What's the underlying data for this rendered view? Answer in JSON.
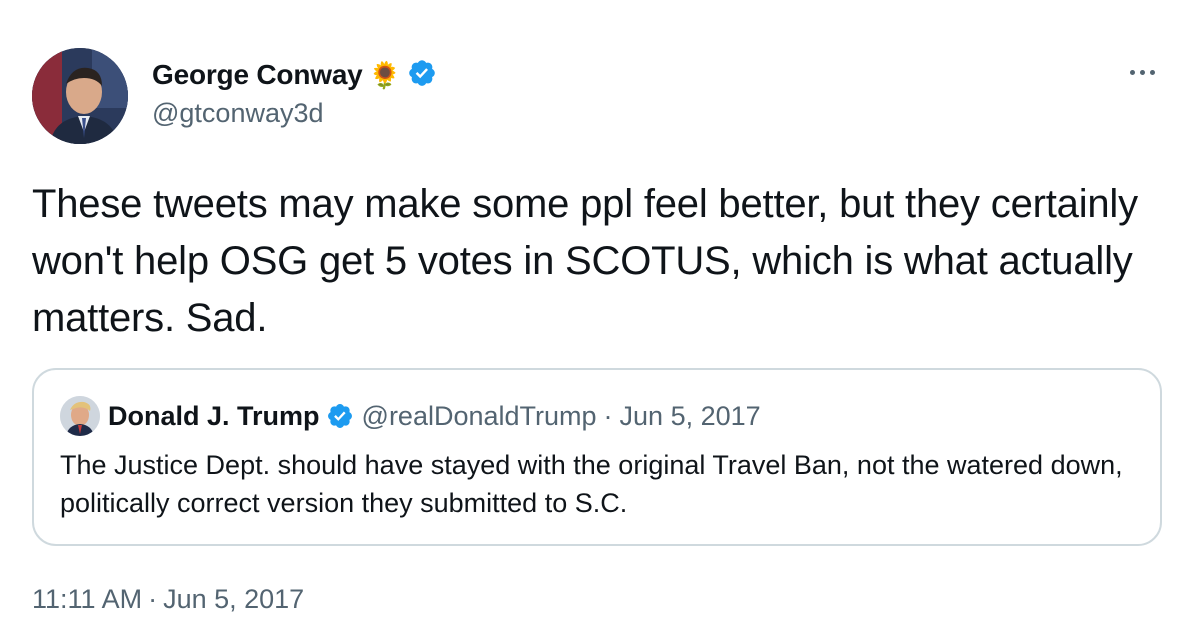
{
  "author": {
    "display_name": "George Conway",
    "emoji": "🌻",
    "handle": "@gtconway3d",
    "verified_icon": "verified-badge-icon"
  },
  "tweet": {
    "text": "These tweets may make some ppl feel better, but they certainly won't help OSG get 5 votes in SCOTUS, which is what actually matters. Sad.",
    "time": "11:11 AM",
    "separator": "·",
    "date": "Jun 5, 2017"
  },
  "quoted_tweet": {
    "display_name": "Donald J. Trump",
    "handle": "@realDonaldTrump",
    "separator": "·",
    "date": "Jun 5, 2017",
    "text": "The Justice Dept. should have stayed with the original Travel Ban, not the watered down, politically correct version they submitted to S.C."
  },
  "icons": {
    "more": "more-options-icon",
    "verified": "verified-badge-icon"
  },
  "colors": {
    "text_primary": "#0f1419",
    "text_secondary": "#536471",
    "verified_blue": "#1d9bf0",
    "border": "#cfd9de"
  }
}
